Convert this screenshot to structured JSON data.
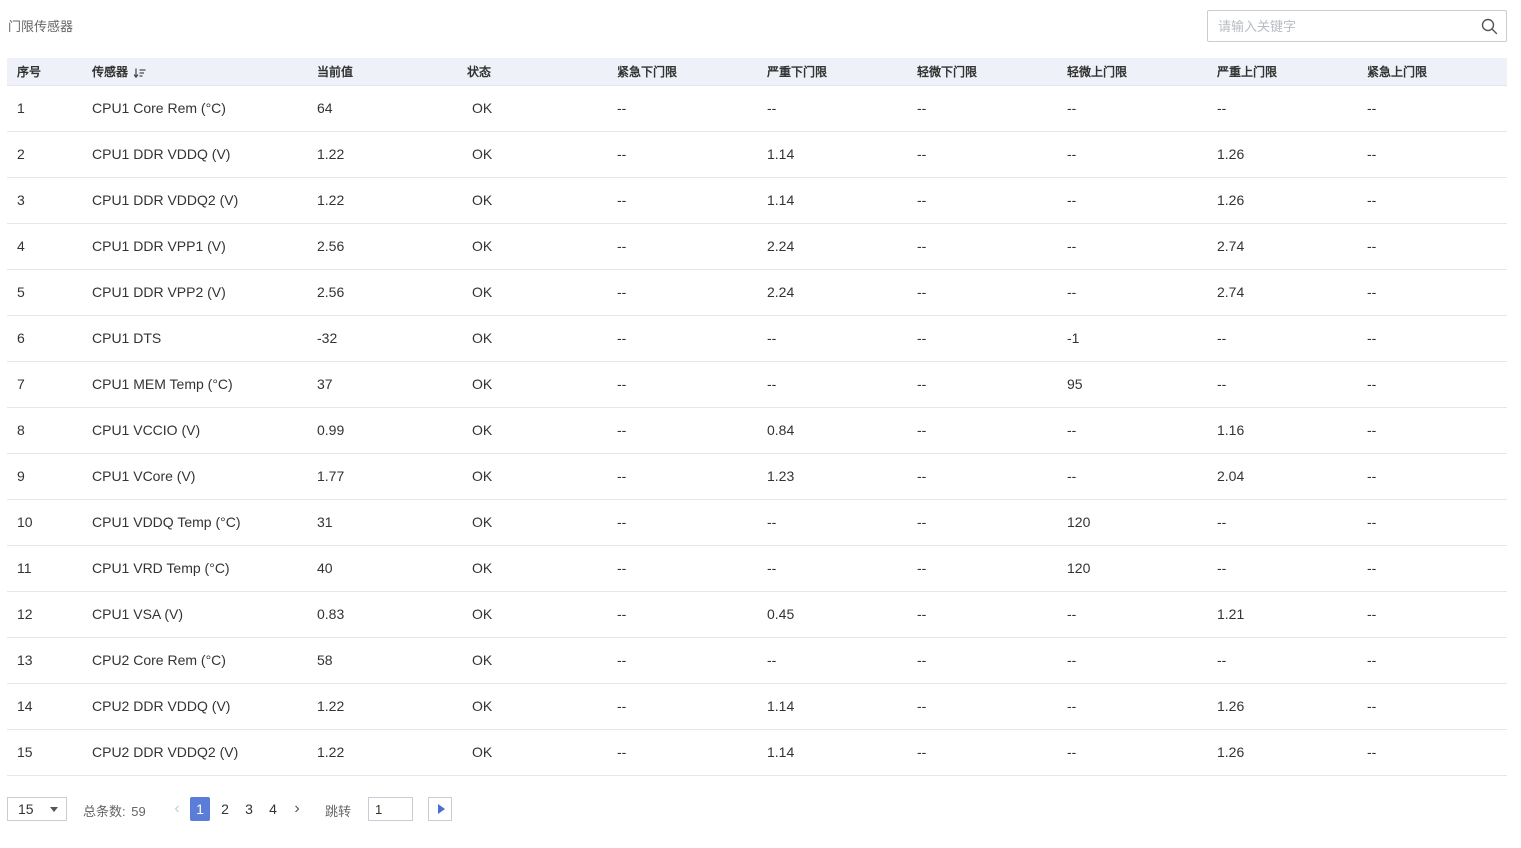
{
  "page": {
    "title": "门限传感器"
  },
  "search": {
    "placeholder": "请输入关键字",
    "icon": "search-icon"
  },
  "table": {
    "columns": [
      "序号",
      "传感器",
      "当前值",
      "状态",
      "紧急下门限",
      "严重下门限",
      "轻微下门限",
      "轻微上门限",
      "严重上门限",
      "紧急上门限"
    ],
    "rows": [
      [
        "1",
        "CPU1 Core Rem (°C)",
        "64",
        "OK",
        "--",
        "--",
        "--",
        "--",
        "--",
        "--"
      ],
      [
        "2",
        "CPU1 DDR VDDQ (V)",
        "1.22",
        "OK",
        "--",
        "1.14",
        "--",
        "--",
        "1.26",
        "--"
      ],
      [
        "3",
        "CPU1 DDR VDDQ2 (V)",
        "1.22",
        "OK",
        "--",
        "1.14",
        "--",
        "--",
        "1.26",
        "--"
      ],
      [
        "4",
        "CPU1 DDR VPP1 (V)",
        "2.56",
        "OK",
        "--",
        "2.24",
        "--",
        "--",
        "2.74",
        "--"
      ],
      [
        "5",
        "CPU1 DDR VPP2 (V)",
        "2.56",
        "OK",
        "--",
        "2.24",
        "--",
        "--",
        "2.74",
        "--"
      ],
      [
        "6",
        "CPU1 DTS",
        "-32",
        "OK",
        "--",
        "--",
        "--",
        "-1",
        "--",
        "--"
      ],
      [
        "7",
        "CPU1 MEM Temp (°C)",
        "37",
        "OK",
        "--",
        "--",
        "--",
        "95",
        "--",
        "--"
      ],
      [
        "8",
        "CPU1 VCCIO (V)",
        "0.99",
        "OK",
        "--",
        "0.84",
        "--",
        "--",
        "1.16",
        "--"
      ],
      [
        "9",
        "CPU1 VCore (V)",
        "1.77",
        "OK",
        "--",
        "1.23",
        "--",
        "--",
        "2.04",
        "--"
      ],
      [
        "10",
        "CPU1 VDDQ Temp (°C)",
        "31",
        "OK",
        "--",
        "--",
        "--",
        "120",
        "--",
        "--"
      ],
      [
        "11",
        "CPU1 VRD Temp (°C)",
        "40",
        "OK",
        "--",
        "--",
        "--",
        "120",
        "--",
        "--"
      ],
      [
        "12",
        "CPU1 VSA (V)",
        "0.83",
        "OK",
        "--",
        "0.45",
        "--",
        "--",
        "1.21",
        "--"
      ],
      [
        "13",
        "CPU2 Core Rem (°C)",
        "58",
        "OK",
        "--",
        "--",
        "--",
        "--",
        "--",
        "--"
      ],
      [
        "14",
        "CPU2 DDR VDDQ (V)",
        "1.22",
        "OK",
        "--",
        "1.14",
        "--",
        "--",
        "1.26",
        "--"
      ],
      [
        "15",
        "CPU2 DDR VDDQ2 (V)",
        "1.22",
        "OK",
        "--",
        "1.14",
        "--",
        "--",
        "1.26",
        "--"
      ]
    ]
  },
  "pagination": {
    "page_size": "15",
    "total_label": "总条数:",
    "total_count": "59",
    "pages": [
      "1",
      "2",
      "3",
      "4"
    ],
    "active_page": "1",
    "jump_label": "跳转",
    "jump_value": "1",
    "accent_color": "#5a7dd8"
  }
}
